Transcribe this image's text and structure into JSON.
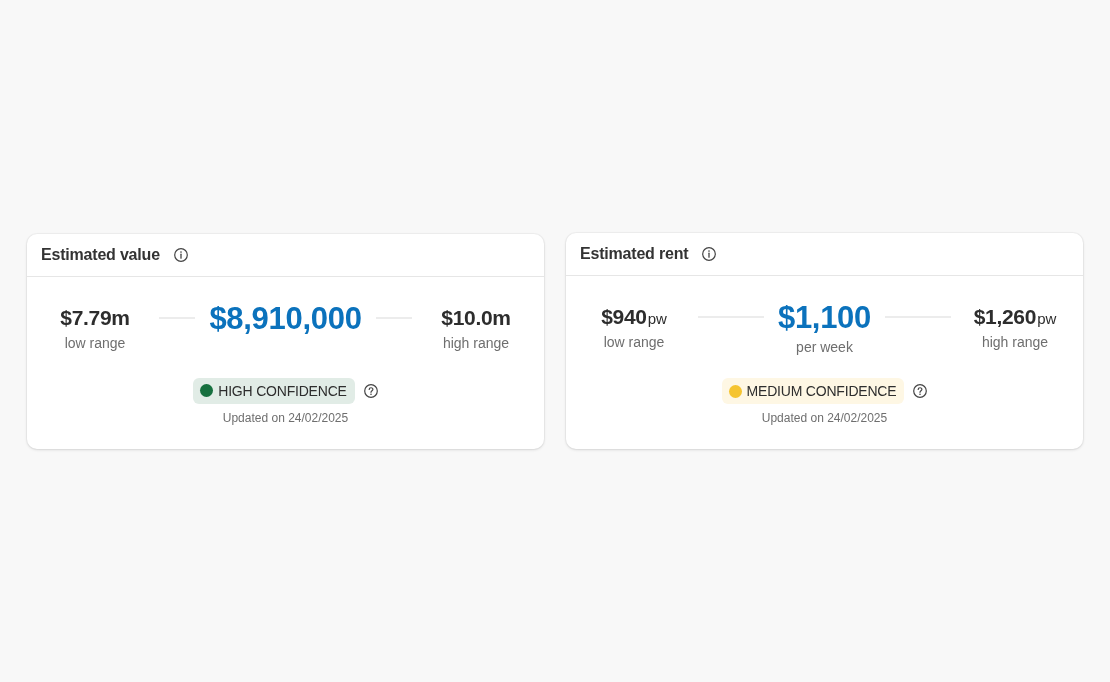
{
  "cards": [
    {
      "title": "Estimated value",
      "low": {
        "amount": "$7.79m",
        "label": "low range"
      },
      "estimate": {
        "amount": "$8,910,000"
      },
      "high": {
        "amount": "$10.0m",
        "label": "high range"
      },
      "confidence": {
        "label": "HIGH CONFIDENCE",
        "color": "#16703f"
      },
      "updated": "Updated on 24/02/2025"
    },
    {
      "title": "Estimated rent",
      "low": {
        "amount": "$940",
        "unit": "pw",
        "label": "low range"
      },
      "estimate": {
        "amount": "$1,100",
        "label": "per week"
      },
      "high": {
        "amount": "$1,260",
        "unit": "pw",
        "label": "high range"
      },
      "confidence": {
        "label": "MEDIUM CONFIDENCE",
        "color": "#f5c430"
      },
      "updated": "Updated on 24/02/2025"
    }
  ]
}
